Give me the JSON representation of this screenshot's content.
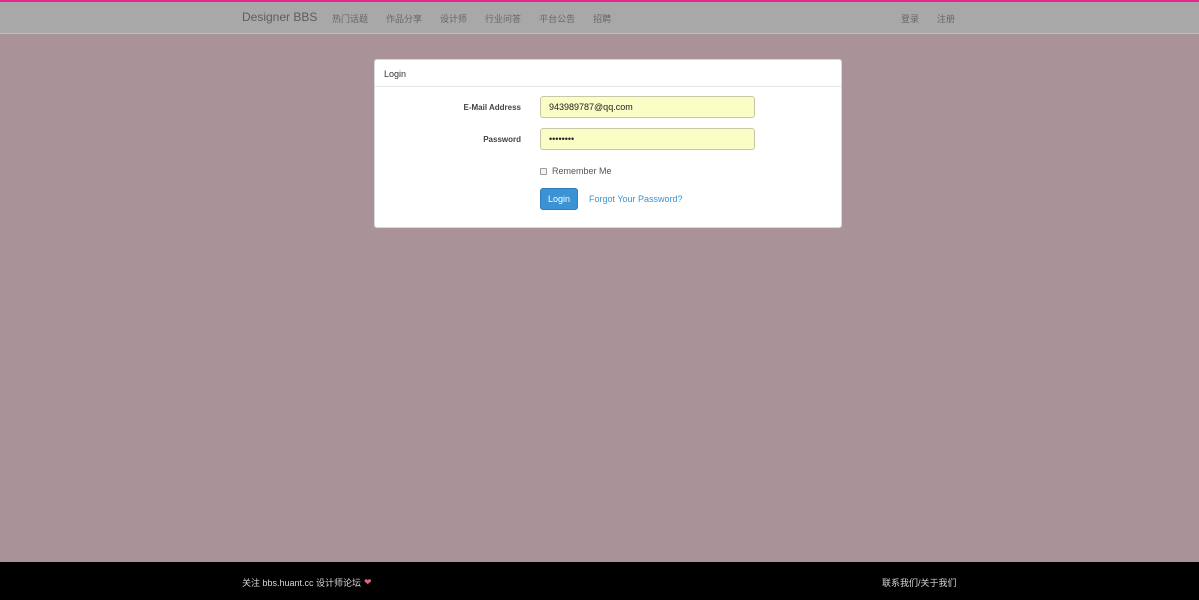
{
  "navbar": {
    "brand": "Designer BBS",
    "links": [
      "热门话题",
      "作品分享",
      "设计师",
      "行业问答",
      "平台公告",
      "招聘"
    ],
    "right_links": [
      "登录",
      "注册"
    ]
  },
  "login_panel": {
    "title": "Login",
    "email_label": "E-Mail Address",
    "email_value": "943989787@qq.com",
    "password_label": "Password",
    "password_value": "••••••••",
    "remember_label": "Remember Me",
    "remember_checked": false,
    "login_button": "Login",
    "forgot_link": "Forgot Your Password?"
  },
  "footer": {
    "left_text": "关注 bbs.huant.cc 设计师论坛",
    "heart_icon": "heart-icon",
    "right_text": "联系我们/关于我们"
  },
  "colors": {
    "accent_stripe": "#e8278c",
    "background": "#a99399",
    "button": "#3b93d3",
    "link": "#3a92d2",
    "input_fill": "#fafdc5"
  }
}
